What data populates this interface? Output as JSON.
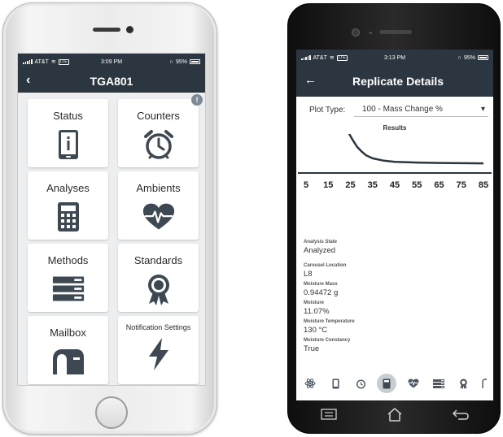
{
  "left_phone": {
    "status_bar": {
      "carrier": "AT&T",
      "network": "LTE",
      "time": "3:09 PM",
      "battery": "95%"
    },
    "nav": {
      "back_label": "‹",
      "title": "TGA801"
    },
    "tiles": [
      {
        "label": "Status",
        "icon": "status-device-icon"
      },
      {
        "label": "Counters",
        "icon": "alarm-clock-icon",
        "badge": "!"
      },
      {
        "label": "Analyses",
        "icon": "calculator-icon"
      },
      {
        "label": "Ambients",
        "icon": "heart-pulse-icon"
      },
      {
        "label": "Methods",
        "icon": "server-stack-icon"
      },
      {
        "label": "Standards",
        "icon": "award-ribbon-icon"
      },
      {
        "label": "Mailbox",
        "icon": "mailbox-icon"
      },
      {
        "label": "Notification Settings",
        "icon": "lightning-icon"
      }
    ]
  },
  "right_phone": {
    "status_bar": {
      "carrier": "AT&T",
      "network": "LTE",
      "time": "3:13 PM",
      "battery": "95%"
    },
    "nav": {
      "back_label": "←",
      "title": "Replicate Details"
    },
    "plot_type": {
      "label": "Plot Type:",
      "value": "100 - Mass Change %"
    },
    "results_title": "Results",
    "details": [
      {
        "label": "Analysis State",
        "value": "Analyzed"
      },
      {
        "label": "Carousel Location",
        "value": "L8"
      },
      {
        "label": "Moisture Mass",
        "value": "0.94472 g"
      },
      {
        "label": "Moisture",
        "value": "11.07%"
      },
      {
        "label": "Moisture Temperature",
        "value": "130 °C"
      },
      {
        "label": "Moisture Constancy",
        "value": "True"
      }
    ],
    "bottom_tabs": [
      "atom-icon",
      "device-icon",
      "alarm-clock-icon",
      "calculator-icon",
      "heart-pulse-icon",
      "server-stack-icon",
      "award-ribbon-icon",
      "mailbox-icon"
    ],
    "active_tab": "calculator-icon"
  },
  "chart_data": {
    "type": "line",
    "title": "Results",
    "xlabel": "",
    "ylabel": "",
    "xlim": [
      5,
      85
    ],
    "x_ticks": [
      5,
      15,
      25,
      35,
      45,
      55,
      65,
      75,
      85
    ],
    "ylim": [
      0,
      100
    ],
    "y_axis_visible": false,
    "grid": false,
    "series": [
      {
        "x": [
          5,
          10,
          15,
          18,
          20,
          22,
          24,
          26,
          28,
          30,
          32,
          35,
          40,
          45,
          55,
          65,
          75,
          85
        ],
        "y": [
          89,
          89,
          88,
          84,
          76,
          64,
          52,
          42,
          33,
          27,
          22,
          18,
          15,
          13.5,
          12.5,
          12,
          11.7,
          11.5
        ],
        "color": "#2b3640"
      }
    ]
  },
  "colors": {
    "header": "#2b3640",
    "tile_bg": "#ffffff",
    "screen_bg": "#eceef0",
    "icon": "#3d4852"
  }
}
